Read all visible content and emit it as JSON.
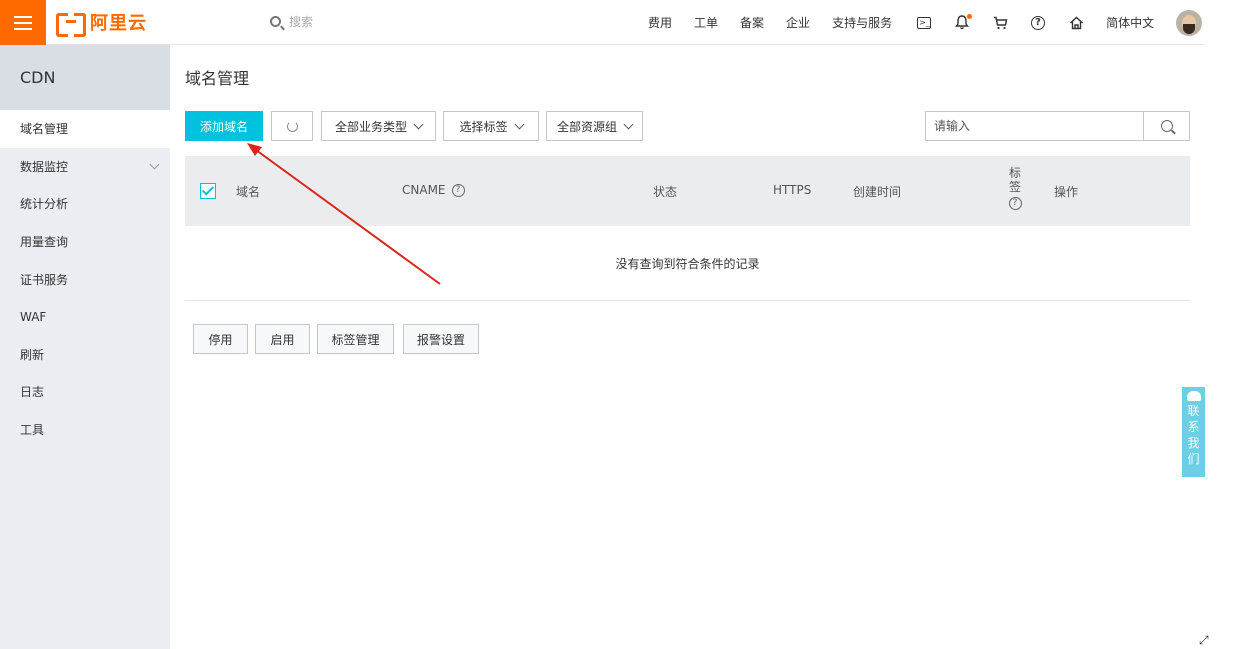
{
  "brand": {
    "logo_text": "阿里云",
    "accent": "#ff6a00"
  },
  "topbar": {
    "search_placeholder": "搜索",
    "nav": [
      "费用",
      "工单",
      "备案",
      "企业",
      "支持与服务"
    ],
    "icons": [
      "terminal-icon",
      "bell-icon",
      "cart-icon",
      "help-icon",
      "home-icon"
    ],
    "language": "简体中文"
  },
  "sidebar": {
    "title": "CDN",
    "items": [
      {
        "label": "域名管理",
        "active": true
      },
      {
        "label": "数据监控"
      },
      {
        "label": "统计分析"
      },
      {
        "label": "用量查询"
      },
      {
        "label": "证书服务"
      },
      {
        "label": "WAF"
      },
      {
        "label": "刷新"
      },
      {
        "label": "日志"
      },
      {
        "label": "工具"
      }
    ]
  },
  "main": {
    "title": "域名管理",
    "toolbar": {
      "add_label": "添加域名",
      "business_type": "全部业务类型",
      "select_tag": "选择标签",
      "resource_group": "全部资源组",
      "search_placeholder": "请输入"
    },
    "table": {
      "columns": [
        "域名",
        "CNAME",
        "状态",
        "HTTPS",
        "创建时间",
        "标签",
        "操作"
      ],
      "tag_col_chars": [
        "标",
        "签"
      ],
      "empty_text": "没有查询到符合条件的记录"
    },
    "bottom_buttons": [
      "停用",
      "启用",
      "标签管理",
      "报警设置"
    ]
  },
  "contact": {
    "chars": [
      "联",
      "系",
      "我",
      "们"
    ]
  },
  "colors": {
    "primary": "#00c1de",
    "annotation_arrow": "#d9261c"
  }
}
